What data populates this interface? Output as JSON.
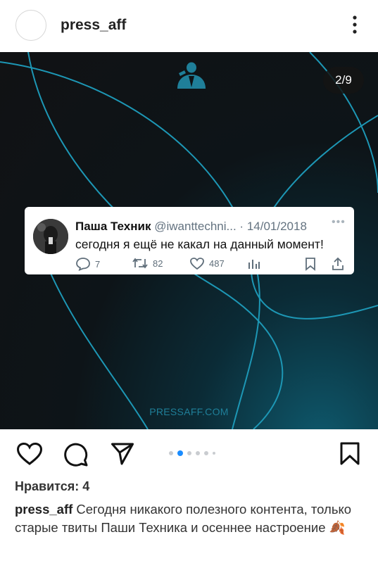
{
  "post": {
    "username": "press_aff",
    "counter": "2/9",
    "watermark": "PRESSAFF.COM"
  },
  "tweet": {
    "name": "Паша Техник",
    "handle": "@iwanttechni...",
    "separator": " · ",
    "date": "14/01/2018",
    "text": "сегодня я ещё не какал на данный момент!",
    "replies": "7",
    "retweets": "82",
    "likes": "487"
  },
  "footer": {
    "likes_label": "Нравится:",
    "likes_count": "4",
    "caption_user": "press_aff",
    "caption_text": "Сегодня никакого полезного контента, только старые твиты Паши Техника и осеннее настроение",
    "caption_emoji": "🍂"
  },
  "carousel": {
    "total_dots": 6,
    "active_index": 1
  },
  "icons": {
    "header": [
      "more-vertical-icon"
    ],
    "actions": [
      "heart-icon",
      "comment-icon",
      "share-icon",
      "bookmark-icon"
    ],
    "tweet": [
      "reply-icon",
      "retweet-icon",
      "like-icon",
      "analytics-icon",
      "tweet-bookmark-icon",
      "tweet-share-icon"
    ],
    "brand": "press-aff-logo-icon"
  },
  "colors": {
    "accent": "#1f7f99",
    "active_dot": "#1a8cff",
    "image_bg": "#111214"
  }
}
